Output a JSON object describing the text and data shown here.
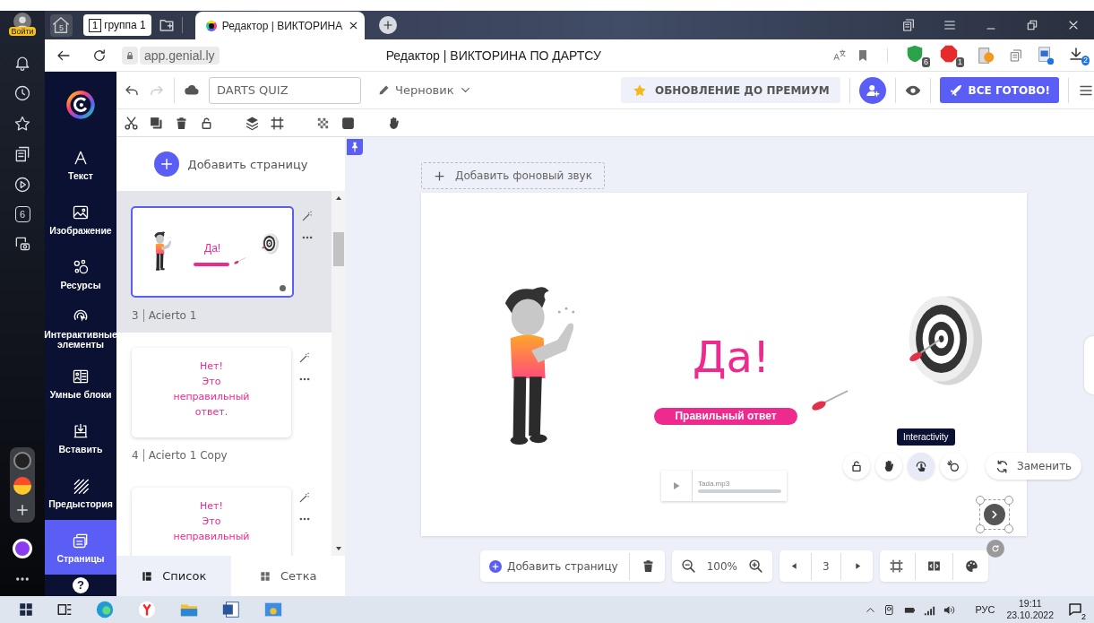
{
  "browser": {
    "profile_label": "Войти",
    "sidebar_badge": "6",
    "home_count": "5",
    "tabs": [
      {
        "kind": "group",
        "number": "1",
        "label": "группа 1"
      },
      {
        "kind": "page",
        "title": "Редактор | ВИКТОРИНА"
      }
    ],
    "address": "app.genial.ly",
    "page_title": "Редактор | ВИКТОРИНА ПО ДАРТСУ",
    "extension_badges": [
      "6",
      "1"
    ],
    "download_badge": "2"
  },
  "editor": {
    "project_name": "DARTS QUIZ",
    "status": "Черновик",
    "premium_button": "ОБНОВЛЕНИЕ ДО ПРЕМИУМ",
    "done_button": "ВСЕ ГОТОВО!",
    "help": "?"
  },
  "nav": [
    {
      "kind": "text",
      "label": "Текст",
      "selected": false
    },
    {
      "kind": "image",
      "label": "Изображение",
      "selected": false
    },
    {
      "kind": "resources",
      "label": "Ресурсы",
      "selected": false
    },
    {
      "kind": "interactive",
      "label": "Интерактивные элементы",
      "selected": false
    },
    {
      "kind": "smart",
      "label": "Умные блоки",
      "selected": false
    },
    {
      "kind": "insert",
      "label": "Вставить",
      "selected": false
    },
    {
      "kind": "background",
      "label": "Предыстория",
      "selected": false
    },
    {
      "kind": "pages",
      "label": "Страницы",
      "selected": true
    }
  ],
  "pages_panel": {
    "add_button": "Добавить страницу",
    "pages": [
      {
        "kind": "correct",
        "number": "3",
        "name": "Acierto 1",
        "selected": true,
        "title": "Да!"
      },
      {
        "kind": "wrong",
        "number": "4",
        "name": "Acierto 1 Copy",
        "selected": false,
        "lines": [
          "Нет!",
          "Это",
          "неправильный",
          "ответ."
        ]
      },
      {
        "kind": "wrong",
        "selected": false,
        "lines": [
          "Нет!",
          "Это",
          "неправильный"
        ]
      }
    ],
    "view_tabs": [
      {
        "kind": "list",
        "label": "Список",
        "selected": true
      },
      {
        "kind": "grid",
        "label": "Сетка",
        "selected": false
      }
    ]
  },
  "canvas": {
    "add_sound": "Добавить фоновый звук",
    "title": "Да!",
    "answer_label": "Правильный ответ",
    "audio_file": "Tada.mp3",
    "tooltip": "Interactivity",
    "replace_button": "Заменить",
    "element_tools": [
      {
        "kind": "lock",
        "selected": false
      },
      {
        "kind": "hand",
        "selected": false
      },
      {
        "kind": "interactivity",
        "selected": true
      },
      {
        "kind": "animation",
        "selected": false
      }
    ]
  },
  "bottom_bar": {
    "add_page": "Добавить страницу",
    "zoom": "100%",
    "page": "3"
  },
  "taskbar": {
    "language": "РУС",
    "time": "19:11",
    "date": "23.10.2022",
    "notification_count": "2"
  }
}
